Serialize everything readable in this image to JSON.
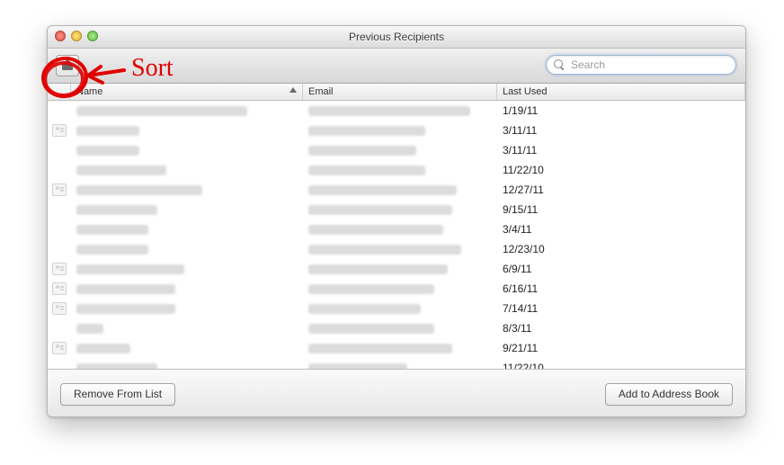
{
  "window": {
    "title": "Previous Recipients"
  },
  "search": {
    "placeholder": "Search",
    "value": ""
  },
  "columns": {
    "name": "Name",
    "email": "Email",
    "last": "Last Used",
    "sort": "name",
    "sort_dir": "asc"
  },
  "rows": [
    {
      "card": false,
      "name_w": 190,
      "email_w": 180,
      "last": "1/19/11"
    },
    {
      "card": true,
      "name_w": 70,
      "email_w": 130,
      "last": "3/11/11"
    },
    {
      "card": false,
      "name_w": 70,
      "email_w": 120,
      "last": "3/11/11"
    },
    {
      "card": false,
      "name_w": 100,
      "email_w": 130,
      "last": "11/22/10"
    },
    {
      "card": true,
      "name_w": 140,
      "email_w": 165,
      "last": "12/27/11"
    },
    {
      "card": false,
      "name_w": 90,
      "email_w": 160,
      "last": "9/15/11"
    },
    {
      "card": false,
      "name_w": 80,
      "email_w": 150,
      "last": "3/4/11"
    },
    {
      "card": false,
      "name_w": 80,
      "email_w": 170,
      "last": "12/23/10"
    },
    {
      "card": true,
      "name_w": 120,
      "email_w": 155,
      "last": "6/9/11"
    },
    {
      "card": true,
      "name_w": 110,
      "email_w": 140,
      "last": "6/16/11"
    },
    {
      "card": true,
      "name_w": 110,
      "email_w": 125,
      "last": "7/14/11"
    },
    {
      "card": false,
      "name_w": 30,
      "email_w": 140,
      "last": "8/3/11"
    },
    {
      "card": true,
      "name_w": 60,
      "email_w": 160,
      "last": "9/21/11"
    },
    {
      "card": false,
      "name_w": 90,
      "email_w": 110,
      "last": "11/22/10"
    }
  ],
  "buttons": {
    "remove": "Remove From List",
    "add": "Add to Address Book"
  },
  "annotation": {
    "label": "Sort",
    "color": "#e00000"
  }
}
